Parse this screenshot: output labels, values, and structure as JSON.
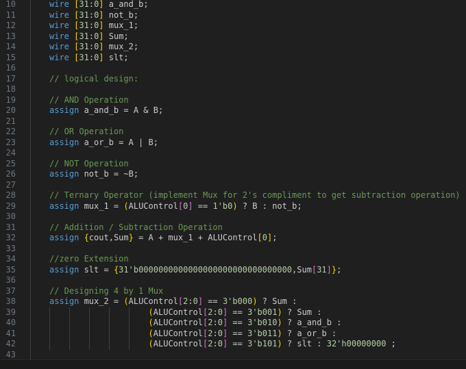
{
  "editor": {
    "language": "verilog",
    "lines": [
      {
        "n": "10",
        "indent": 1,
        "tokens": [
          {
            "t": "wire",
            "c": "kw"
          },
          {
            "t": " ",
            "c": "tx"
          },
          {
            "t": "[",
            "c": "br1"
          },
          {
            "t": "31",
            "c": "num"
          },
          {
            "t": ":",
            "c": "tx"
          },
          {
            "t": "0",
            "c": "num"
          },
          {
            "t": "]",
            "c": "br1"
          },
          {
            "t": " a_and_b;",
            "c": "tx"
          }
        ]
      },
      {
        "n": "11",
        "indent": 1,
        "tokens": [
          {
            "t": "wire",
            "c": "kw"
          },
          {
            "t": " ",
            "c": "tx"
          },
          {
            "t": "[",
            "c": "br1"
          },
          {
            "t": "31",
            "c": "num"
          },
          {
            "t": ":",
            "c": "tx"
          },
          {
            "t": "0",
            "c": "num"
          },
          {
            "t": "]",
            "c": "br1"
          },
          {
            "t": " not_b;",
            "c": "tx"
          }
        ]
      },
      {
        "n": "12",
        "indent": 1,
        "tokens": [
          {
            "t": "wire",
            "c": "kw"
          },
          {
            "t": " ",
            "c": "tx"
          },
          {
            "t": "[",
            "c": "br1"
          },
          {
            "t": "31",
            "c": "num"
          },
          {
            "t": ":",
            "c": "tx"
          },
          {
            "t": "0",
            "c": "num"
          },
          {
            "t": "]",
            "c": "br1"
          },
          {
            "t": " mux_1;",
            "c": "tx"
          }
        ]
      },
      {
        "n": "13",
        "indent": 1,
        "tokens": [
          {
            "t": "wire",
            "c": "kw"
          },
          {
            "t": " ",
            "c": "tx"
          },
          {
            "t": "[",
            "c": "br1"
          },
          {
            "t": "31",
            "c": "num"
          },
          {
            "t": ":",
            "c": "tx"
          },
          {
            "t": "0",
            "c": "num"
          },
          {
            "t": "]",
            "c": "br1"
          },
          {
            "t": " Sum;",
            "c": "tx"
          }
        ]
      },
      {
        "n": "14",
        "indent": 1,
        "tokens": [
          {
            "t": "wire",
            "c": "kw"
          },
          {
            "t": " ",
            "c": "tx"
          },
          {
            "t": "[",
            "c": "br1"
          },
          {
            "t": "31",
            "c": "num"
          },
          {
            "t": ":",
            "c": "tx"
          },
          {
            "t": "0",
            "c": "num"
          },
          {
            "t": "]",
            "c": "br1"
          },
          {
            "t": " mux_2;",
            "c": "tx"
          }
        ]
      },
      {
        "n": "15",
        "indent": 1,
        "tokens": [
          {
            "t": "wire",
            "c": "kw"
          },
          {
            "t": " ",
            "c": "tx"
          },
          {
            "t": "[",
            "c": "br1"
          },
          {
            "t": "31",
            "c": "num"
          },
          {
            "t": ":",
            "c": "tx"
          },
          {
            "t": "0",
            "c": "num"
          },
          {
            "t": "]",
            "c": "br1"
          },
          {
            "t": " slt;",
            "c": "tx"
          }
        ]
      },
      {
        "n": "16",
        "indent": 1,
        "tokens": []
      },
      {
        "n": "17",
        "indent": 1,
        "tokens": [
          {
            "t": "// logical design:",
            "c": "com"
          }
        ]
      },
      {
        "n": "18",
        "indent": 1,
        "tokens": []
      },
      {
        "n": "19",
        "indent": 1,
        "tokens": [
          {
            "t": "// AND Operation",
            "c": "com"
          }
        ]
      },
      {
        "n": "20",
        "indent": 1,
        "tokens": [
          {
            "t": "assign",
            "c": "kw"
          },
          {
            "t": " a_and_b = A & B;",
            "c": "tx"
          }
        ]
      },
      {
        "n": "21",
        "indent": 1,
        "tokens": []
      },
      {
        "n": "22",
        "indent": 1,
        "tokens": [
          {
            "t": "// OR Operation",
            "c": "com"
          }
        ]
      },
      {
        "n": "23",
        "indent": 1,
        "tokens": [
          {
            "t": "assign",
            "c": "kw"
          },
          {
            "t": " a_or_b = A | B;",
            "c": "tx"
          }
        ]
      },
      {
        "n": "24",
        "indent": 1,
        "tokens": []
      },
      {
        "n": "25",
        "indent": 1,
        "tokens": [
          {
            "t": "// NOT Operation",
            "c": "com"
          }
        ]
      },
      {
        "n": "26",
        "indent": 1,
        "tokens": [
          {
            "t": "assign",
            "c": "kw"
          },
          {
            "t": " not_b = ~B;",
            "c": "tx"
          }
        ]
      },
      {
        "n": "27",
        "indent": 1,
        "tokens": []
      },
      {
        "n": "28",
        "indent": 1,
        "tokens": [
          {
            "t": "// Ternary Operator (implement Mux for 2's compliment to get subtraction operation)",
            "c": "com"
          }
        ]
      },
      {
        "n": "29",
        "indent": 1,
        "tokens": [
          {
            "t": "assign",
            "c": "kw"
          },
          {
            "t": " mux_1 = ",
            "c": "tx"
          },
          {
            "t": "(",
            "c": "br1"
          },
          {
            "t": "ALUControl",
            "c": "tx"
          },
          {
            "t": "[",
            "c": "br2"
          },
          {
            "t": "0",
            "c": "num"
          },
          {
            "t": "]",
            "c": "br2"
          },
          {
            "t": " == ",
            "c": "tx"
          },
          {
            "t": "1'b0",
            "c": "num"
          },
          {
            "t": ")",
            "c": "br1"
          },
          {
            "t": " ? B : not_b;",
            "c": "tx"
          }
        ]
      },
      {
        "n": "30",
        "indent": 1,
        "tokens": []
      },
      {
        "n": "31",
        "indent": 1,
        "tokens": [
          {
            "t": "// Addition / Subtraction Operation",
            "c": "com"
          }
        ]
      },
      {
        "n": "32",
        "indent": 1,
        "tokens": [
          {
            "t": "assign",
            "c": "kw"
          },
          {
            "t": " ",
            "c": "tx"
          },
          {
            "t": "{",
            "c": "br1"
          },
          {
            "t": "cout,Sum",
            "c": "tx"
          },
          {
            "t": "}",
            "c": "br1"
          },
          {
            "t": " = A + mux_1 + ALUControl",
            "c": "tx"
          },
          {
            "t": "[",
            "c": "br1"
          },
          {
            "t": "0",
            "c": "num"
          },
          {
            "t": "]",
            "c": "br1"
          },
          {
            "t": ";",
            "c": "tx"
          }
        ]
      },
      {
        "n": "33",
        "indent": 1,
        "tokens": []
      },
      {
        "n": "34",
        "indent": 1,
        "tokens": [
          {
            "t": "//zero Extension",
            "c": "com"
          }
        ]
      },
      {
        "n": "35",
        "indent": 1,
        "tokens": [
          {
            "t": "assign",
            "c": "kw"
          },
          {
            "t": " slt = ",
            "c": "tx"
          },
          {
            "t": "{",
            "c": "br1"
          },
          {
            "t": "31'b0000000000000000000000000000000",
            "c": "num"
          },
          {
            "t": ",Sum",
            "c": "tx"
          },
          {
            "t": "[",
            "c": "br2"
          },
          {
            "t": "31",
            "c": "num"
          },
          {
            "t": "]",
            "c": "br2"
          },
          {
            "t": "}",
            "c": "br1"
          },
          {
            "t": ";",
            "c": "tx"
          }
        ]
      },
      {
        "n": "36",
        "indent": 1,
        "tokens": []
      },
      {
        "n": "37",
        "indent": 1,
        "tokens": [
          {
            "t": "// Designing 4 by 1 Mux",
            "c": "com"
          }
        ]
      },
      {
        "n": "38",
        "indent": 1,
        "tokens": [
          {
            "t": "assign",
            "c": "kw"
          },
          {
            "t": " mux_2 = ",
            "c": "tx"
          },
          {
            "t": "(",
            "c": "br1"
          },
          {
            "t": "ALUControl",
            "c": "tx"
          },
          {
            "t": "[",
            "c": "br2"
          },
          {
            "t": "2",
            "c": "num"
          },
          {
            "t": ":",
            "c": "tx"
          },
          {
            "t": "0",
            "c": "num"
          },
          {
            "t": "]",
            "c": "br2"
          },
          {
            "t": " == ",
            "c": "tx"
          },
          {
            "t": "3'b000",
            "c": "num"
          },
          {
            "t": ")",
            "c": "br1"
          },
          {
            "t": " ? Sum :",
            "c": "tx"
          }
        ]
      },
      {
        "n": "39",
        "indent": 6,
        "tokens": [
          {
            "t": "(",
            "c": "br1"
          },
          {
            "t": "ALUControl",
            "c": "tx"
          },
          {
            "t": "[",
            "c": "br2"
          },
          {
            "t": "2",
            "c": "num"
          },
          {
            "t": ":",
            "c": "tx"
          },
          {
            "t": "0",
            "c": "num"
          },
          {
            "t": "]",
            "c": "br2"
          },
          {
            "t": " == ",
            "c": "tx"
          },
          {
            "t": "3'b001",
            "c": "num"
          },
          {
            "t": ")",
            "c": "br1"
          },
          {
            "t": " ? Sum :",
            "c": "tx"
          }
        ]
      },
      {
        "n": "40",
        "indent": 6,
        "tokens": [
          {
            "t": "(",
            "c": "br1"
          },
          {
            "t": "ALUControl",
            "c": "tx"
          },
          {
            "t": "[",
            "c": "br2"
          },
          {
            "t": "2",
            "c": "num"
          },
          {
            "t": ":",
            "c": "tx"
          },
          {
            "t": "0",
            "c": "num"
          },
          {
            "t": "]",
            "c": "br2"
          },
          {
            "t": " == ",
            "c": "tx"
          },
          {
            "t": "3'b010",
            "c": "num"
          },
          {
            "t": ")",
            "c": "br1"
          },
          {
            "t": " ? a_and_b :",
            "c": "tx"
          }
        ]
      },
      {
        "n": "41",
        "indent": 6,
        "tokens": [
          {
            "t": "(",
            "c": "br1"
          },
          {
            "t": "ALUControl",
            "c": "tx"
          },
          {
            "t": "[",
            "c": "br2"
          },
          {
            "t": "2",
            "c": "num"
          },
          {
            "t": ":",
            "c": "tx"
          },
          {
            "t": "0",
            "c": "num"
          },
          {
            "t": "]",
            "c": "br2"
          },
          {
            "t": " == ",
            "c": "tx"
          },
          {
            "t": "3'b011",
            "c": "num"
          },
          {
            "t": ")",
            "c": "br1"
          },
          {
            "t": " ? a_or_b :",
            "c": "tx"
          }
        ]
      },
      {
        "n": "42",
        "indent": 6,
        "tokens": [
          {
            "t": "(",
            "c": "br1"
          },
          {
            "t": "ALUControl",
            "c": "tx"
          },
          {
            "t": "[",
            "c": "br2"
          },
          {
            "t": "2",
            "c": "num"
          },
          {
            "t": ":",
            "c": "tx"
          },
          {
            "t": "0",
            "c": "num"
          },
          {
            "t": "]",
            "c": "br2"
          },
          {
            "t": " == ",
            "c": "tx"
          },
          {
            "t": "3'b101",
            "c": "num"
          },
          {
            "t": ")",
            "c": "br1"
          },
          {
            "t": " ? slt : ",
            "c": "tx"
          },
          {
            "t": "32'h00000000",
            "c": "num"
          },
          {
            "t": " ;",
            "c": "tx"
          }
        ]
      },
      {
        "n": "43",
        "indent": 1,
        "tokens": []
      }
    ]
  },
  "colors": {
    "background": "#1f1f1f",
    "line_number": "#6e7681",
    "keyword": "#569cd6",
    "number": "#b5cea8",
    "comment": "#6a9955",
    "text": "#cccccc",
    "bracket_level_1": "#ffd700",
    "bracket_level_2": "#da70d6",
    "indent_guide": "#404040"
  }
}
